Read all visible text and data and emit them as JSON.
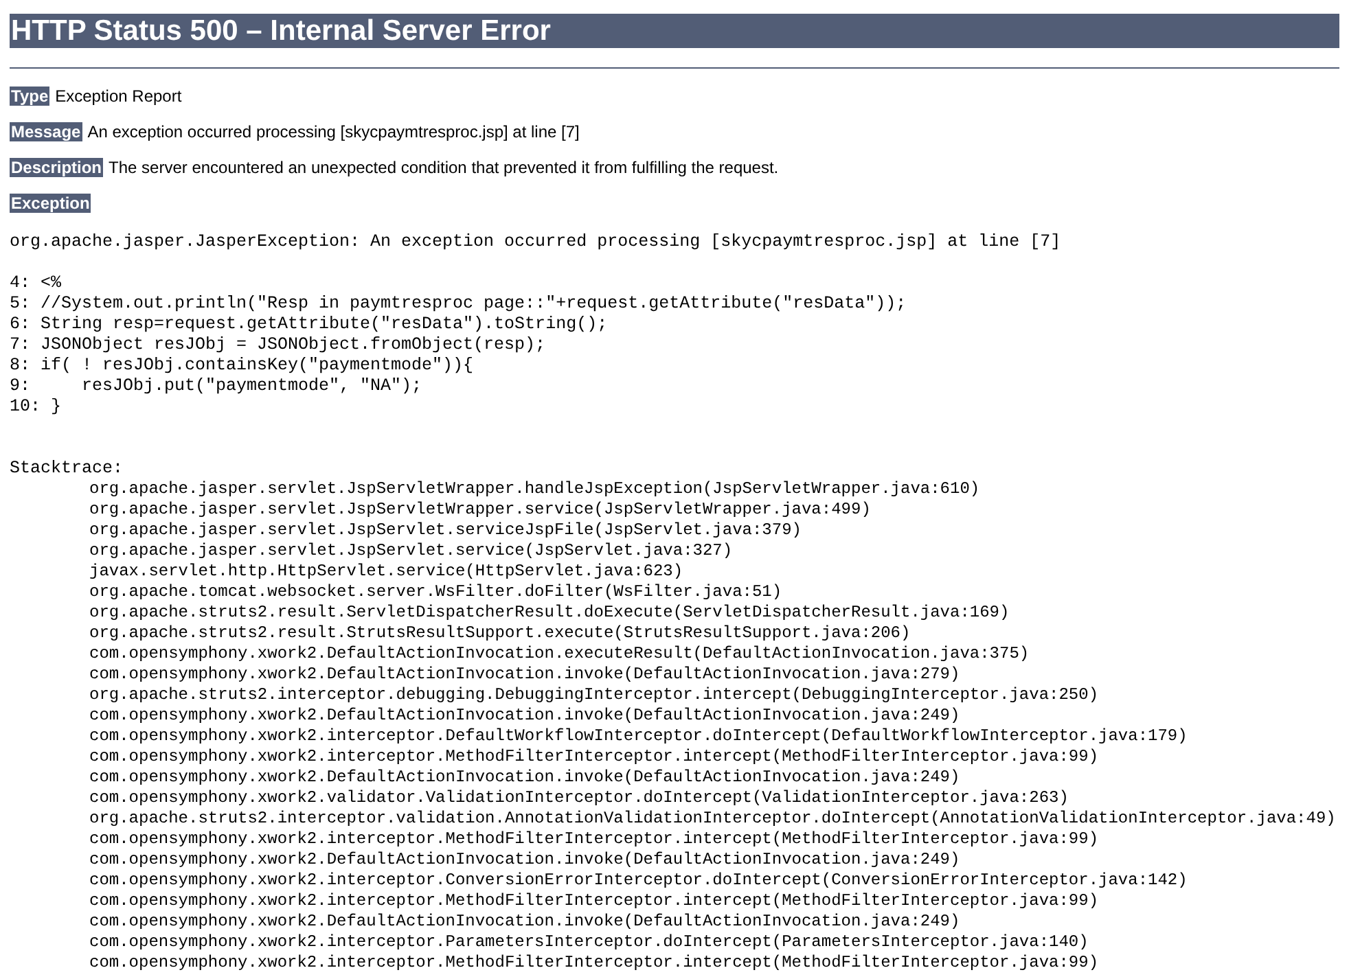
{
  "title": "HTTP Status 500 – Internal Server Error",
  "fields": [
    {
      "label": "Type",
      "value": "Exception Report"
    },
    {
      "label": "Message",
      "value": "An exception occurred processing [skycpaymtresproc.jsp] at line [7]"
    },
    {
      "label": "Description",
      "value": "The server encountered an unexpected condition that prevented it from fulfilling the request."
    }
  ],
  "exception_label": "Exception",
  "exception_message": "org.apache.jasper.JasperException: An exception occurred processing [skycpaymtresproc.jsp] at line [7]",
  "code_lines": [
    "4: <%",
    "5: //System.out.println(\"Resp in paymtresproc page::\"+request.getAttribute(\"resData\"));",
    "6: String resp=request.getAttribute(\"resData\").toString();",
    "7: JSONObject resJObj = JSONObject.fromObject(resp);",
    "8: if( ! resJObj.containsKey(\"paymentmode\")){",
    "9:     resJObj.put(\"paymentmode\", \"NA\");",
    "10: }"
  ],
  "stacktrace_label": "Stacktrace:",
  "stacktrace_lines": [
    "org.apache.jasper.servlet.JspServletWrapper.handleJspException(JspServletWrapper.java:610)",
    "org.apache.jasper.servlet.JspServletWrapper.service(JspServletWrapper.java:499)",
    "org.apache.jasper.servlet.JspServlet.serviceJspFile(JspServlet.java:379)",
    "org.apache.jasper.servlet.JspServlet.service(JspServlet.java:327)",
    "javax.servlet.http.HttpServlet.service(HttpServlet.java:623)",
    "org.apache.tomcat.websocket.server.WsFilter.doFilter(WsFilter.java:51)",
    "org.apache.struts2.result.ServletDispatcherResult.doExecute(ServletDispatcherResult.java:169)",
    "org.apache.struts2.result.StrutsResultSupport.execute(StrutsResultSupport.java:206)",
    "com.opensymphony.xwork2.DefaultActionInvocation.executeResult(DefaultActionInvocation.java:375)",
    "com.opensymphony.xwork2.DefaultActionInvocation.invoke(DefaultActionInvocation.java:279)",
    "org.apache.struts2.interceptor.debugging.DebuggingInterceptor.intercept(DebuggingInterceptor.java:250)",
    "com.opensymphony.xwork2.DefaultActionInvocation.invoke(DefaultActionInvocation.java:249)",
    "com.opensymphony.xwork2.interceptor.DefaultWorkflowInterceptor.doIntercept(DefaultWorkflowInterceptor.java:179)",
    "com.opensymphony.xwork2.interceptor.MethodFilterInterceptor.intercept(MethodFilterInterceptor.java:99)",
    "com.opensymphony.xwork2.DefaultActionInvocation.invoke(DefaultActionInvocation.java:249)",
    "com.opensymphony.xwork2.validator.ValidationInterceptor.doIntercept(ValidationInterceptor.java:263)",
    "org.apache.struts2.interceptor.validation.AnnotationValidationInterceptor.doIntercept(AnnotationValidationInterceptor.java:49)",
    "com.opensymphony.xwork2.interceptor.MethodFilterInterceptor.intercept(MethodFilterInterceptor.java:99)",
    "com.opensymphony.xwork2.DefaultActionInvocation.invoke(DefaultActionInvocation.java:249)",
    "com.opensymphony.xwork2.interceptor.ConversionErrorInterceptor.doIntercept(ConversionErrorInterceptor.java:142)",
    "com.opensymphony.xwork2.interceptor.MethodFilterInterceptor.intercept(MethodFilterInterceptor.java:99)",
    "com.opensymphony.xwork2.DefaultActionInvocation.invoke(DefaultActionInvocation.java:249)",
    "com.opensymphony.xwork2.interceptor.ParametersInterceptor.doIntercept(ParametersInterceptor.java:140)",
    "com.opensymphony.xwork2.interceptor.MethodFilterInterceptor.intercept(MethodFilterInterceptor.java:99)"
  ]
}
